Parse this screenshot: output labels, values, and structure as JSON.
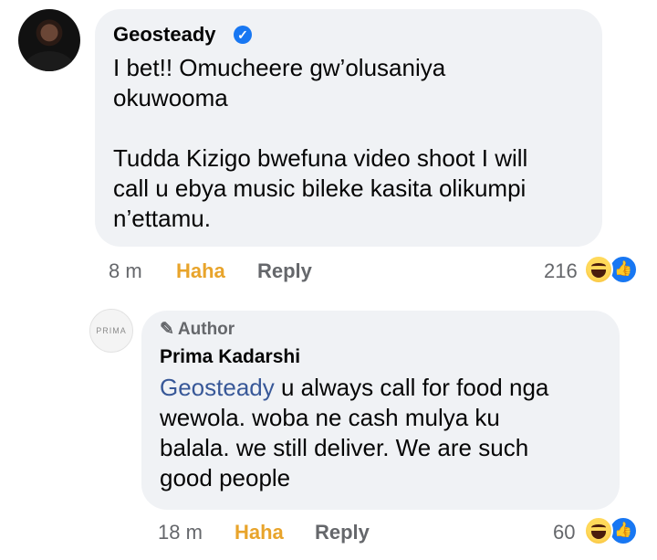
{
  "comment": {
    "author": "Geosteady",
    "verified_icon": "verified-badge-icon",
    "text": "I bet!! Omucheere gw’olusaniya\nokuwooma\n\nTudda Kizigo bwefuna video shoot I will\ncall u ebya music bileke kasita olikumpi\nn’ettamu.",
    "time": "8 m",
    "reaction_label": "Haha",
    "reply_label": "Reply",
    "reaction_count": "216"
  },
  "reply": {
    "avatar_text": "PRIMA",
    "author_badge": "Author",
    "author": "Prima Kadarshi",
    "mention": "Geosteady",
    "text": " u always call for food nga\nwewola. woba ne cash mulya ku\nbalala. we still deliver. We are such\ngood people",
    "time": "18 m",
    "reaction_label": "Haha",
    "reply_label": "Reply",
    "reaction_count": "60"
  },
  "colors": {
    "bubble": "#f0f2f5",
    "haha_text": "#e8a42b",
    "mention": "#385898",
    "like_blue": "#1877f2",
    "muted": "#65676b"
  }
}
